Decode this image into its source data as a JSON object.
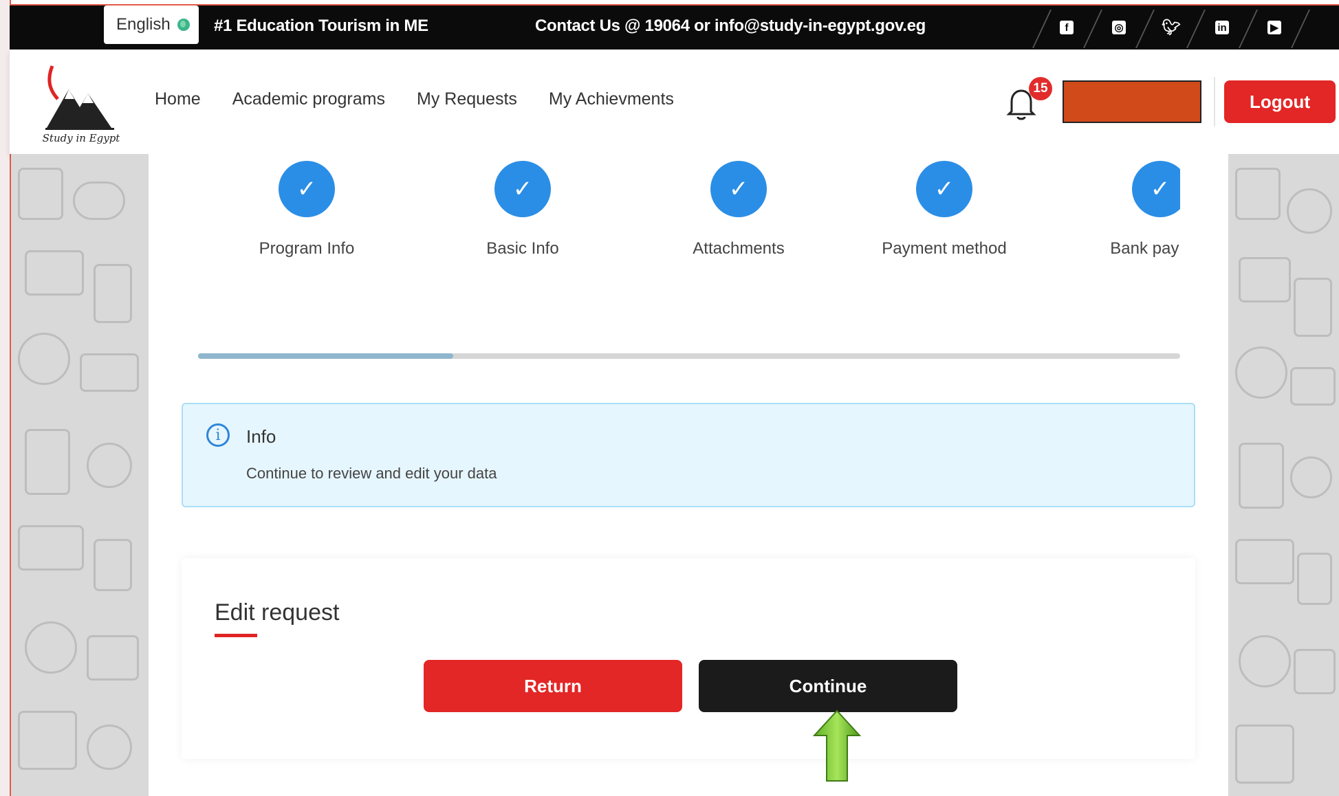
{
  "topbar": {
    "language": "English",
    "tagline": "#1 Education Tourism in ME",
    "contact": "Contact Us @ 19064 or info@study-in-egypt.gov.eg",
    "social_icons": [
      "facebook-icon",
      "instagram-icon",
      "twitter-icon",
      "linkedin-icon",
      "youtube-icon"
    ]
  },
  "header": {
    "logo_text": "Study in Egypt",
    "nav": [
      "Home",
      "Academic programs",
      "My Requests",
      "My Achievments"
    ],
    "notification_count": "15",
    "logout_label": "Logout"
  },
  "steps": [
    {
      "label": "Program Info",
      "done": true
    },
    {
      "label": "Basic Info",
      "done": true
    },
    {
      "label": "Attachments",
      "done": true
    },
    {
      "label": "Payment method",
      "done": true
    },
    {
      "label": "Bank pay info",
      "done": true
    }
  ],
  "progress": {
    "fraction": 0.26
  },
  "info": {
    "title": "Info",
    "text": "Continue to review and edit your data"
  },
  "edit": {
    "title": "Edit request",
    "return_label": "Return",
    "continue_label": "Continue"
  },
  "colors": {
    "accent_red": "#e32626",
    "step_blue": "#2b8ee6",
    "dark": "#1b1b1b"
  }
}
